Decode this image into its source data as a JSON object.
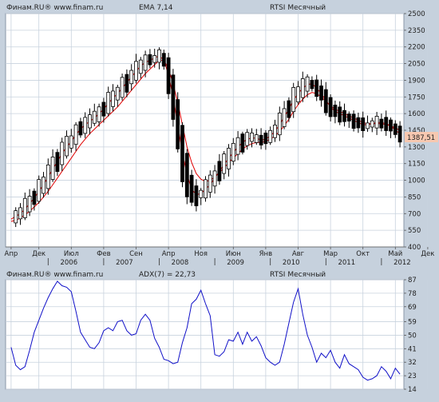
{
  "colors": {
    "background": "#c6d1dd",
    "plot_bg": "#ffffff",
    "grid": "#c8d2de",
    "candle": "#000000",
    "ema": "#e00000",
    "adx": "#1010c8",
    "price_box": "#f7c8b0",
    "price_text": "#000000",
    "ema_label": "#d00000",
    "adx_label": "#1010c8"
  },
  "price_panel": {
    "source_label": "Финам.RU® www.finam.ru",
    "indicator_label": "EMA 7,14",
    "chart_title": "RTSI Месячный",
    "last_price_label": "1387,51",
    "y_ticks": [
      "2500",
      "2350",
      "2200",
      "2050",
      "1900",
      "1750",
      "1600",
      "1450",
      "1300",
      "1150",
      "1000",
      "850",
      "700",
      "550",
      "400"
    ]
  },
  "indicator_panel": {
    "source_label": "Финам.RU® www.finam.ru",
    "indicator_label": "ADX(7) = 22,73",
    "chart_title": "RTSI Месячный",
    "y_ticks": [
      "87",
      "78",
      "69",
      "59",
      "50",
      "41",
      "32",
      "23",
      "14"
    ]
  },
  "x_axis": {
    "month_labels": [
      "Апр",
      "Дек",
      "Июл",
      "Фев",
      "Сен",
      "Апр",
      "Ноя",
      "Июн",
      "Янв",
      "Авг",
      "Мар",
      "Окт",
      "Май",
      "Дек"
    ],
    "year_labels": [
      "2006",
      "2007",
      "2008",
      "2009",
      "2010",
      "2011",
      "2012"
    ]
  },
  "chart_data": [
    {
      "type": "candlestick",
      "title": "RTSI Месячный",
      "ylim": [
        400,
        2500
      ],
      "y_ticks": [
        2500,
        2350,
        2200,
        2050,
        1900,
        1750,
        1600,
        1450,
        1300,
        1150,
        1000,
        850,
        700,
        550,
        400
      ],
      "x_tick_labels": [
        "Апр",
        "Дек",
        "Июл",
        "Фев",
        "Сен",
        "Апр",
        "Ноя",
        "Июн",
        "Янв",
        "Авг",
        "Мар",
        "Окт",
        "Май",
        "Дек"
      ],
      "year_labels": [
        "2006",
        "2007",
        "2008",
        "2009",
        "2010",
        "2011",
        "2012"
      ],
      "last_value_label": "1387,51",
      "series": [
        {
          "name": "EMA 7,14",
          "values": [
            650,
            675,
            700,
            740,
            790,
            840,
            900,
            960,
            1030,
            1100,
            1170,
            1240,
            1300,
            1350,
            1410,
            1460,
            1500,
            1530,
            1560,
            1600,
            1640,
            1690,
            1740,
            1780,
            1830,
            1880,
            1930,
            1980,
            2030,
            2060,
            2080,
            2100,
            2120,
            2080,
            1950,
            1750,
            1500,
            1250,
            1050,
            920,
            870,
            880,
            920,
            960,
            1020,
            1080,
            1140,
            1200,
            1250,
            1300,
            1340,
            1370,
            1380,
            1380,
            1360,
            1370,
            1400,
            1440,
            1500,
            1570,
            1640,
            1720,
            1780,
            1830,
            1860,
            1870,
            1830,
            1780,
            1720,
            1660,
            1620,
            1600,
            1580,
            1560,
            1540,
            1520,
            1500,
            1500,
            1510,
            1520,
            1520,
            1510,
            1490,
            1450,
            1420
          ]
        },
        {
          "name": "EMA 14",
          "values": [
            630,
            640,
            660,
            690,
            720,
            760,
            800,
            850,
            900,
            960,
            1020,
            1080,
            1140,
            1200,
            1260,
            1320,
            1370,
            1420,
            1460,
            1500,
            1540,
            1580,
            1620,
            1660,
            1710,
            1760,
            1810,
            1860,
            1910,
            1960,
            2000,
            2040,
            2080,
            2080,
            2000,
            1870,
            1700,
            1500,
            1300,
            1160,
            1060,
            1010,
            990,
            1000,
            1030,
            1070,
            1110,
            1160,
            1200,
            1240,
            1280,
            1310,
            1330,
            1340,
            1340,
            1350,
            1370,
            1400,
            1440,
            1490,
            1550,
            1620,
            1680,
            1730,
            1770,
            1790,
            1780,
            1750,
            1710,
            1670,
            1640,
            1620,
            1600,
            1580,
            1560,
            1540,
            1520,
            1510,
            1510,
            1510,
            1510,
            1500,
            1490,
            1470,
            1450
          ]
        }
      ]
    },
    {
      "type": "line",
      "title": "RTSI Месячный",
      "ylim": [
        14,
        87
      ],
      "y_ticks": [
        87,
        78,
        69,
        59,
        50,
        41,
        32,
        23,
        14
      ],
      "last_value_label": "ADX(7) = 22,73",
      "series": [
        {
          "name": "ADX(7)",
          "values": [
            42,
            30,
            27,
            29,
            40,
            52,
            60,
            68,
            75,
            81,
            86,
            83,
            82,
            79,
            66,
            52,
            47,
            42,
            41,
            45,
            53,
            55,
            53,
            59,
            60,
            53,
            50,
            51,
            60,
            64,
            60,
            48,
            42,
            34,
            33,
            31,
            32,
            45,
            55,
            71,
            74,
            80,
            71,
            63,
            37,
            36,
            39,
            47,
            46,
            52,
            44,
            52,
            46,
            49,
            43,
            35,
            32,
            30,
            32,
            44,
            58,
            72,
            81,
            64,
            50,
            42,
            32,
            38,
            35,
            40,
            32,
            28,
            37,
            31,
            29,
            27,
            22,
            20,
            21,
            23,
            29,
            26,
            21,
            28,
            24
          ]
        }
      ]
    }
  ]
}
